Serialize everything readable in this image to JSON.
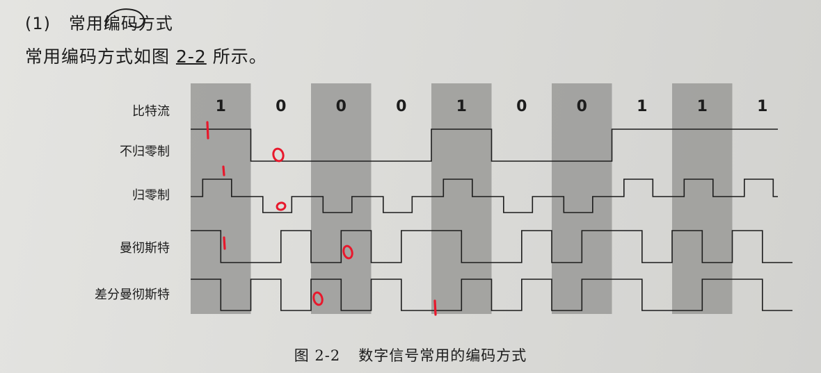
{
  "heading": {
    "number": "(1)",
    "title": "常用编码方式"
  },
  "intro": {
    "before": "常用编码方式如图 ",
    "figure_ref": "2-2",
    "after": " 所示。"
  },
  "figure": {
    "row_labels": {
      "bitstream": "比特流",
      "nrz": "不归零制",
      "rz": "归零制",
      "manchester": "曼彻斯特",
      "diff_manchester": "差分曼彻斯特"
    },
    "bits": [
      "1",
      "0",
      "0",
      "0",
      "1",
      "0",
      "0",
      "1",
      "1",
      "1"
    ],
    "shaded_bits": [
      0,
      2,
      4,
      6,
      8
    ],
    "caption_number": "图 2-2",
    "caption_title": "数字信号常用的编码方式"
  },
  "annotations": {
    "color": "#e8182c",
    "marks": [
      "1",
      "0",
      "1",
      "0",
      "1",
      "0",
      "0",
      "1"
    ]
  },
  "colors": {
    "paper": "#dcdcd9",
    "shade": "#9a9a98",
    "ink": "#1c1c1c",
    "pen_red": "#e8182c"
  }
}
